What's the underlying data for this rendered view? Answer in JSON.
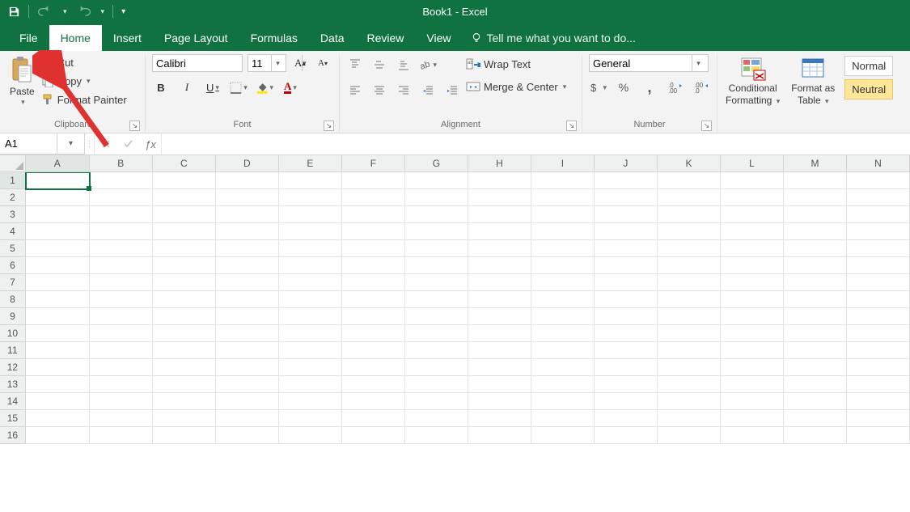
{
  "title": "Book1 - Excel",
  "tabs": {
    "file": "File",
    "home": "Home",
    "insert": "Insert",
    "page_layout": "Page Layout",
    "formulas": "Formulas",
    "data": "Data",
    "review": "Review",
    "view": "View"
  },
  "tell_me": "Tell me what you want to do...",
  "clipboard": {
    "paste": "Paste",
    "cut": "Cut",
    "copy": "Copy",
    "format_painter": "Format Painter",
    "label": "Clipboard"
  },
  "font": {
    "name": "Calibri",
    "size": "11",
    "bold": "B",
    "italic": "I",
    "underline": "U",
    "label": "Font"
  },
  "alignment": {
    "wrap": "Wrap Text",
    "merge": "Merge & Center",
    "label": "Alignment"
  },
  "number": {
    "format": "General",
    "label": "Number"
  },
  "styles": {
    "cond": "Conditional",
    "cond2": "Formatting",
    "table": "Format as",
    "table2": "Table",
    "normal": "Normal",
    "neutral": "Neutral"
  },
  "namebox": "A1",
  "columns": [
    "A",
    "B",
    "C",
    "D",
    "E",
    "F",
    "G",
    "H",
    "I",
    "J",
    "K",
    "L",
    "M",
    "N"
  ],
  "rows": [
    1,
    2,
    3,
    4,
    5,
    6,
    7,
    8,
    9,
    10,
    11,
    12,
    13,
    14,
    15,
    16
  ],
  "active_cell": {
    "col": "A",
    "row": 1
  },
  "col_widths": {
    "A": 82,
    "default": 81
  }
}
